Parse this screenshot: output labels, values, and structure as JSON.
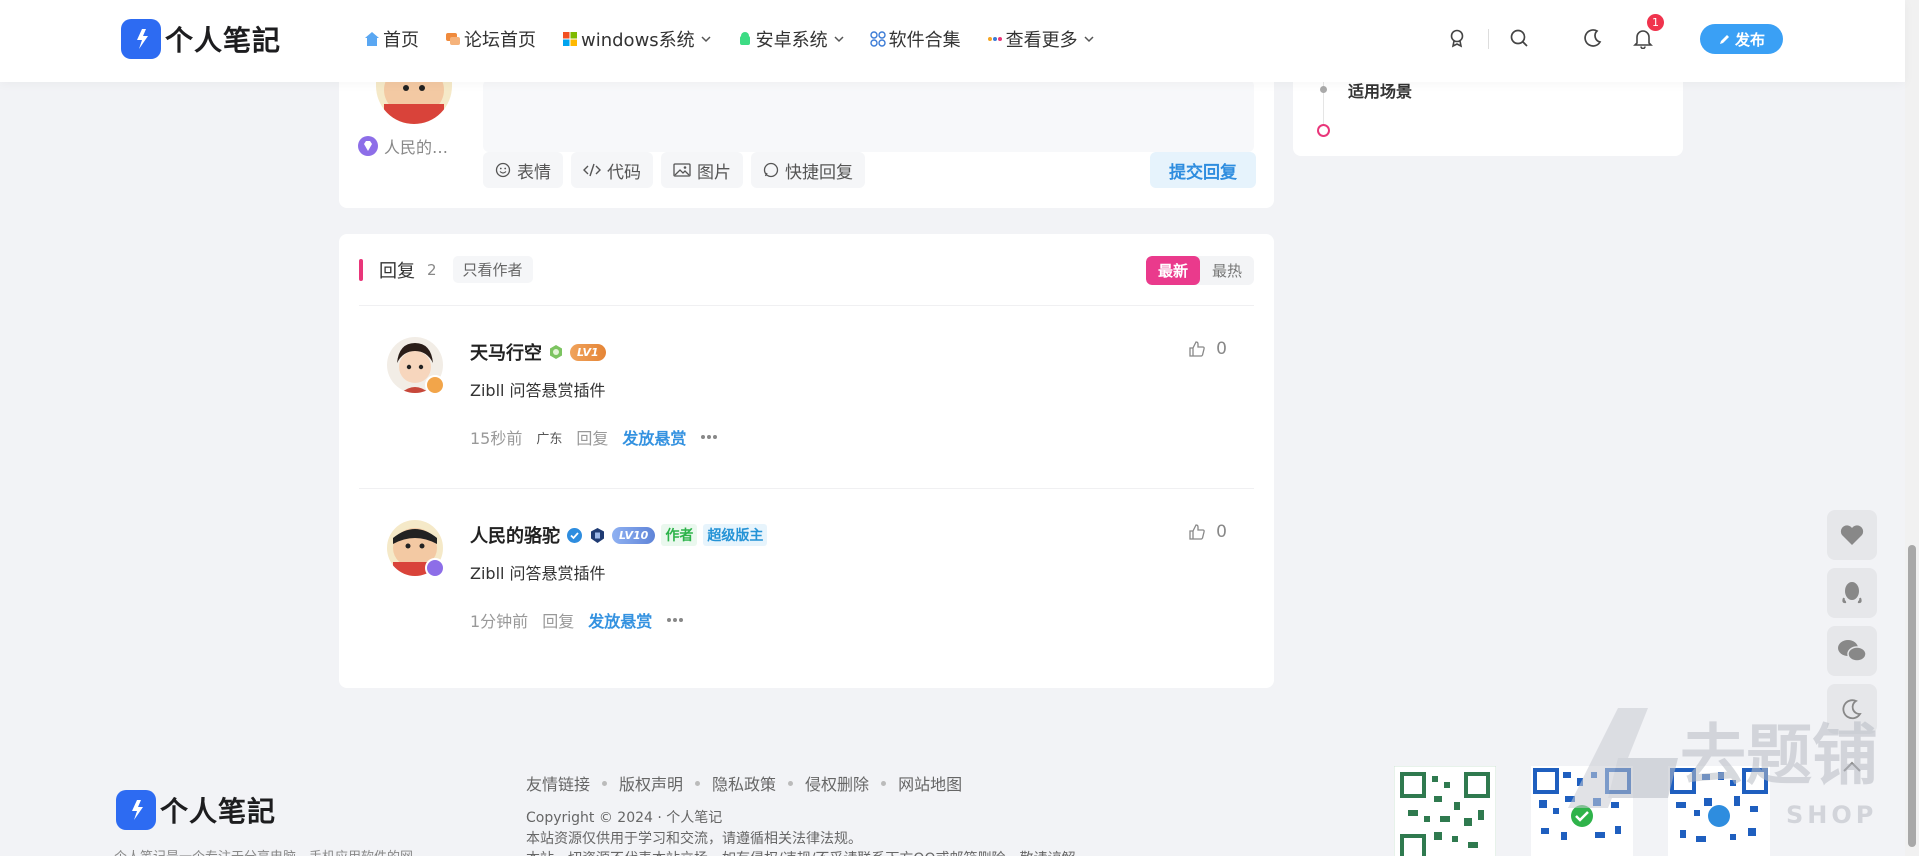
{
  "header": {
    "logo_text": "个人笔記",
    "nav": [
      {
        "label": "首页",
        "icon": "home-icon",
        "has_dropdown": false
      },
      {
        "label": "论坛首页",
        "icon": "forum-icon",
        "has_dropdown": false
      },
      {
        "label": "windows系统",
        "icon": "windows-icon",
        "has_dropdown": true
      },
      {
        "label": "安卓系统",
        "icon": "android-icon",
        "has_dropdown": true
      },
      {
        "label": "软件合集",
        "icon": "apps-icon",
        "has_dropdown": false
      },
      {
        "label": "查看更多",
        "icon": "more-dots-icon",
        "has_dropdown": true
      }
    ],
    "notification_count": "1",
    "publish_label": "发布"
  },
  "editor": {
    "member_name": "人民的…",
    "tools": [
      "表情",
      "代码",
      "图片",
      "快捷回复"
    ],
    "submit_label": "提交回复"
  },
  "comments": {
    "title": "回复",
    "count": "2",
    "only_author": "只看作者",
    "sort_latest": "最新",
    "sort_hot": "最热",
    "items": [
      {
        "name": "天马行空",
        "level": "LV1",
        "text": "Zibll 问答悬赏插件",
        "time": "15秒前",
        "location": "广东",
        "reply": "回复",
        "reward": "发放悬赏",
        "likes": "0"
      },
      {
        "name": "人民的骆驼",
        "level": "LV10",
        "tag_author": "作者",
        "tag_mod": "超级版主",
        "text": "Zibll 问答悬赏插件",
        "time": "1分钟前",
        "reply": "回复",
        "reward": "发放悬赏",
        "likes": "0"
      }
    ]
  },
  "sidebar": {
    "toc_item": "适用场景"
  },
  "footer": {
    "logo_text": "个人笔記",
    "links": [
      "友情链接",
      "版权声明",
      "隐私政策",
      "侵权删除",
      "网站地图"
    ],
    "copyright": "Copyright © 2024 · 个人笔记",
    "notice": "本站资源仅供用于学习和交流，请遵循相关法律法规。",
    "notice2": "本站一切资源不代表本站立场，如有侵权/违规/不妥请联系下方QQ或邮箱删除，敬请谅解。",
    "about": "个人笔记是一个专注于分享电脑、手机应用软件的网"
  },
  "watermark": {
    "text": "去题铺",
    "sub": "SHOP"
  },
  "colors": {
    "accent": "#3aa0f5",
    "pink": "#ea3a8c",
    "link": "#3492e0"
  }
}
